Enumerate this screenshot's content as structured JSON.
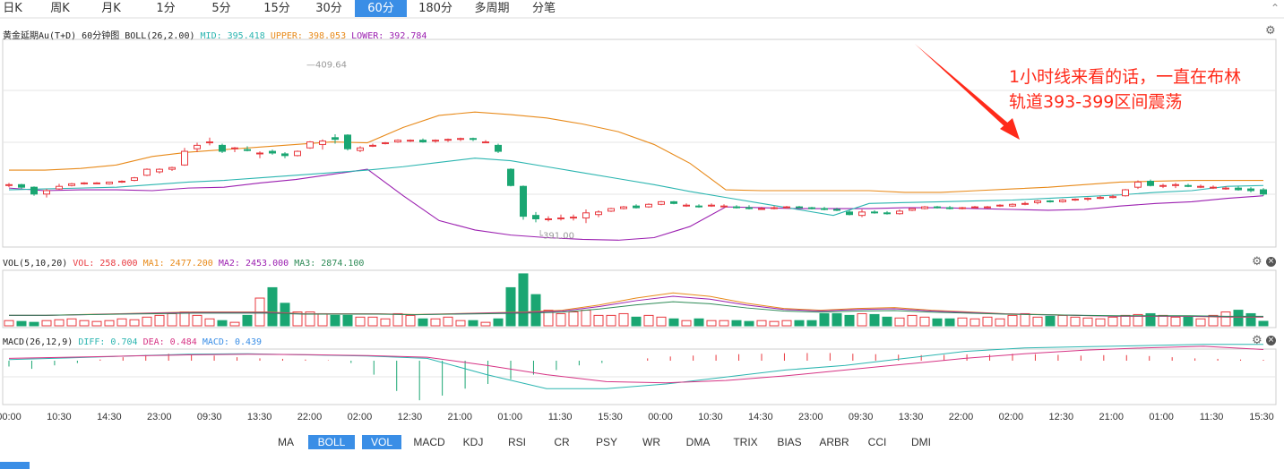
{
  "period_tabs": [
    {
      "label": "日K",
      "active": false
    },
    {
      "label": "周K",
      "active": false
    },
    {
      "label": "月K",
      "active": false
    },
    {
      "label": "1分",
      "active": false
    },
    {
      "label": "5分",
      "active": false
    },
    {
      "label": "15分",
      "active": false
    },
    {
      "label": "30分",
      "active": false
    },
    {
      "label": "60分",
      "active": true
    },
    {
      "label": "180分",
      "active": false
    },
    {
      "label": "多周期",
      "active": false
    },
    {
      "label": "分笔",
      "active": false
    }
  ],
  "boll_header": {
    "title": "黄金延期Au(T+D) 60分钟图 BOLL(26,2.00)",
    "mid": "MID: 395.418",
    "upper": "UPPER: 398.053",
    "lower": "LOWER: 392.784"
  },
  "vol_header": {
    "title": "VOL(5,10,20)",
    "vol": "VOL: 258.000",
    "ma1": "MA1: 2477.200",
    "ma2": "MA2: 2453.000",
    "ma3": "MA3: 2874.100"
  },
  "macd_header": {
    "title": "MACD(26,12,9)",
    "diff": "DIFF: 0.704",
    "dea": "DEA: 0.484",
    "macd": "MACD: 0.439"
  },
  "annotation": [
    "1小时线来看的话，一直在布林",
    "轨道393-399区间震荡"
  ],
  "price_marks": {
    "high": "409.64",
    "low": "391.00"
  },
  "x_axis_labels": [
    "00:00",
    "10:30",
    "14:30",
    "23:00",
    "09:30",
    "13:30",
    "22:00",
    "02:00",
    "12:30",
    "21:00",
    "01:00",
    "11:30",
    "15:30",
    "00:00",
    "10:30",
    "14:30",
    "23:00",
    "09:30",
    "13:30",
    "22:00",
    "02:00",
    "12:30",
    "21:00",
    "01:00",
    "11:30",
    "15:30"
  ],
  "indicator_tabs": [
    {
      "label": "MA",
      "active": false
    },
    {
      "label": "BOLL",
      "active": true
    },
    {
      "label": "VOL",
      "active": true
    },
    {
      "label": "MACD",
      "active": false
    },
    {
      "label": "KDJ",
      "active": false
    },
    {
      "label": "RSI",
      "active": false
    },
    {
      "label": "CR",
      "active": false
    },
    {
      "label": "PSY",
      "active": false
    },
    {
      "label": "WR",
      "active": false
    },
    {
      "label": "DMA",
      "active": false
    },
    {
      "label": "TRIX",
      "active": false
    },
    {
      "label": "BIAS",
      "active": false
    },
    {
      "label": "ARBR",
      "active": false
    },
    {
      "label": "CCI",
      "active": false
    },
    {
      "label": "DMI",
      "active": false
    }
  ],
  "colors": {
    "up": "#e8393f",
    "down": "#1aa672",
    "mid": "#2bb5b0",
    "upper": "#e88a1a",
    "lower": "#9b1fb0",
    "accent": "#3a8ee6",
    "annotation": "#ff2a1a",
    "ma1": "#e06666",
    "ma2": "#8a2be2",
    "ma3": "#2e8b57",
    "dea": "#d63384"
  },
  "chart_data": {
    "type": "candlestick",
    "title": "黄金延期Au(T+D) 60分钟图",
    "ylim": [
      388.2,
      412.5
    ],
    "candles": [
      [
        395.4,
        395.7,
        395.2,
        395.5
      ],
      [
        395.5,
        395.6,
        395.0,
        395.2
      ],
      [
        395.2,
        395.3,
        394.2,
        394.4
      ],
      [
        394.4,
        395.0,
        394.0,
        394.8
      ],
      [
        395.0,
        395.6,
        394.9,
        395.3
      ],
      [
        395.4,
        395.7,
        395.3,
        395.6
      ],
      [
        395.6,
        395.8,
        395.5,
        395.7
      ],
      [
        395.7,
        395.8,
        395.6,
        395.7
      ],
      [
        395.6,
        395.8,
        395.5,
        395.8
      ],
      [
        395.9,
        396.0,
        395.7,
        395.9
      ],
      [
        396.0,
        396.4,
        395.9,
        396.3
      ],
      [
        396.6,
        397.4,
        396.5,
        397.3
      ],
      [
        397.0,
        397.4,
        396.8,
        397.3
      ],
      [
        397.3,
        397.6,
        397.1,
        397.5
      ],
      [
        397.8,
        399.8,
        397.7,
        399.4
      ],
      [
        399.7,
        400.4,
        399.3,
        400.1
      ],
      [
        400.4,
        401.0,
        400.1,
        400.5
      ],
      [
        400.1,
        400.3,
        399.2,
        399.4
      ],
      [
        399.7,
        399.9,
        399.3,
        399.8
      ],
      [
        399.6,
        400.0,
        399.4,
        399.5
      ],
      [
        399.1,
        399.4,
        398.6,
        399.2
      ],
      [
        399.4,
        399.6,
        399.0,
        399.2
      ],
      [
        399.1,
        399.3,
        398.6,
        398.9
      ],
      [
        398.9,
        399.5,
        398.8,
        399.4
      ],
      [
        399.8,
        400.6,
        399.7,
        400.5
      ],
      [
        400.2,
        400.8,
        399.6,
        400.6
      ],
      [
        401.0,
        401.4,
        400.3,
        400.8
      ],
      [
        401.3,
        401.4,
        399.5,
        399.7
      ],
      [
        399.5,
        400.0,
        399.3,
        399.8
      ],
      [
        400.0,
        400.3,
        399.9,
        400.1
      ],
      [
        400.3,
        400.5,
        400.2,
        400.4
      ],
      [
        400.5,
        400.8,
        400.4,
        400.7
      ],
      [
        400.6,
        400.8,
        400.5,
        400.7
      ],
      [
        400.7,
        400.9,
        400.4,
        400.5
      ],
      [
        400.6,
        400.8,
        400.4,
        400.7
      ],
      [
        400.7,
        400.9,
        400.5,
        400.8
      ],
      [
        400.8,
        401.0,
        400.6,
        400.9
      ],
      [
        400.9,
        401.0,
        400.6,
        400.8
      ],
      [
        400.5,
        400.7,
        400.4,
        400.5
      ],
      [
        400.1,
        400.3,
        399.2,
        399.4
      ],
      [
        397.3,
        397.4,
        395.3,
        395.4
      ],
      [
        395.3,
        395.4,
        391.4,
        391.8
      ],
      [
        391.9,
        392.3,
        391.1,
        391.5
      ],
      [
        391.5,
        391.8,
        391.2,
        391.5
      ],
      [
        391.5,
        392.0,
        391.3,
        391.6
      ],
      [
        391.6,
        392.0,
        391.3,
        391.7
      ],
      [
        391.6,
        392.6,
        391.0,
        392.2
      ],
      [
        392.0,
        392.5,
        391.7,
        392.3
      ],
      [
        392.4,
        392.8,
        392.3,
        392.7
      ],
      [
        392.7,
        393.0,
        392.6,
        392.9
      ],
      [
        393.0,
        393.2,
        392.7,
        392.8
      ],
      [
        392.9,
        393.3,
        392.8,
        393.2
      ],
      [
        393.2,
        393.6,
        393.1,
        393.5
      ],
      [
        393.5,
        393.6,
        393.2,
        393.3
      ],
      [
        393.1,
        393.3,
        392.9,
        393.1
      ],
      [
        393.0,
        393.2,
        392.8,
        392.9
      ],
      [
        393.0,
        393.3,
        392.9,
        393.1
      ],
      [
        393.0,
        393.2,
        392.9,
        393.0
      ],
      [
        392.9,
        393.1,
        392.7,
        392.8
      ],
      [
        392.8,
        393.1,
        392.6,
        392.7
      ],
      [
        392.7,
        392.9,
        392.6,
        392.7
      ],
      [
        392.8,
        393.0,
        392.6,
        392.8
      ],
      [
        392.8,
        393.0,
        392.7,
        392.9
      ],
      [
        392.9,
        393.0,
        392.7,
        392.8
      ],
      [
        392.8,
        392.9,
        392.6,
        392.7
      ],
      [
        392.7,
        392.9,
        392.5,
        392.6
      ],
      [
        392.6,
        392.8,
        392.4,
        392.5
      ],
      [
        392.3,
        392.5,
        391.9,
        392.0
      ],
      [
        391.9,
        392.6,
        391.7,
        392.3
      ],
      [
        392.3,
        392.5,
        392.1,
        392.2
      ],
      [
        392.2,
        392.4,
        392.0,
        392.1
      ],
      [
        392.1,
        392.6,
        392.0,
        392.4
      ],
      [
        392.5,
        392.8,
        392.4,
        392.7
      ],
      [
        392.7,
        393.0,
        392.6,
        392.9
      ],
      [
        392.9,
        393.0,
        392.7,
        392.8
      ],
      [
        392.8,
        393.0,
        392.6,
        392.7
      ],
      [
        392.7,
        392.9,
        392.6,
        392.8
      ],
      [
        392.8,
        393.0,
        392.7,
        392.9
      ],
      [
        392.8,
        393.0,
        392.7,
        392.9
      ],
      [
        393.0,
        393.2,
        392.9,
        393.1
      ],
      [
        393.0,
        393.3,
        392.9,
        393.2
      ],
      [
        393.2,
        393.5,
        393.1,
        393.3
      ],
      [
        393.4,
        393.7,
        393.2,
        393.6
      ],
      [
        393.6,
        393.7,
        393.4,
        393.5
      ],
      [
        393.5,
        393.8,
        393.4,
        393.7
      ],
      [
        393.7,
        393.9,
        393.6,
        393.8
      ],
      [
        393.8,
        394.0,
        393.6,
        393.9
      ],
      [
        393.9,
        394.2,
        393.8,
        394.0
      ],
      [
        394.0,
        394.3,
        393.9,
        394.1
      ],
      [
        394.2,
        395.0,
        394.1,
        394.9
      ],
      [
        395.2,
        396.0,
        395.0,
        395.8
      ],
      [
        395.9,
        396.1,
        395.3,
        395.4
      ],
      [
        395.3,
        395.6,
        395.1,
        395.4
      ],
      [
        395.4,
        395.7,
        395.1,
        395.5
      ],
      [
        395.4,
        395.6,
        395.2,
        395.3
      ],
      [
        395.3,
        395.5,
        395.1,
        395.3
      ],
      [
        395.2,
        395.4,
        395.0,
        395.2
      ],
      [
        395.1,
        395.3,
        394.9,
        395.1
      ],
      [
        395.1,
        395.3,
        394.8,
        394.9
      ],
      [
        395.0,
        395.2,
        394.6,
        394.8
      ],
      [
        394.9,
        395.1,
        394.2,
        394.4
      ]
    ],
    "mid": [
      394.9,
      395.0,
      395.1,
      395.2,
      395.5,
      395.8,
      396.0,
      396.3,
      396.6,
      396.9,
      397.2,
      397.6,
      398.1,
      398.6,
      398.3,
      397.6,
      396.9,
      396.2,
      395.5,
      394.7,
      394.0,
      393.3,
      392.6,
      391.9,
      393.3,
      393.4,
      393.5,
      393.6,
      393.7,
      393.9,
      394.1,
      394.3,
      394.6,
      394.8,
      395.3,
      395.4
    ],
    "upper": [
      397.2,
      397.2,
      397.4,
      397.8,
      398.8,
      399.3,
      399.6,
      399.9,
      400.2,
      400.5,
      400.4,
      402.2,
      403.6,
      404.0,
      403.7,
      403.3,
      402.6,
      401.7,
      400.2,
      398.0,
      394.9,
      394.8,
      394.8,
      394.8,
      394.8,
      394.6,
      394.6,
      394.8,
      395.0,
      395.2,
      395.5,
      395.8,
      395.9,
      396.0,
      396.0,
      396.0
    ],
    "lower": [
      395.1,
      394.8,
      394.9,
      394.9,
      394.8,
      395.1,
      395.2,
      395.7,
      396.1,
      396.7,
      397.3,
      394.2,
      391.3,
      390.2,
      389.6,
      389.3,
      389.1,
      389.0,
      389.3,
      390.6,
      392.9,
      392.8,
      392.7,
      392.7,
      392.7,
      392.8,
      392.8,
      392.7,
      392.6,
      392.5,
      392.6,
      393.0,
      393.3,
      393.5,
      393.9,
      394.2
    ],
    "volume": [
      300,
      250,
      200,
      300,
      350,
      400,
      300,
      250,
      300,
      400,
      350,
      500,
      600,
      700,
      800,
      600,
      400,
      300,
      200,
      600,
      1600,
      2200,
      1300,
      800,
      800,
      700,
      600,
      600,
      500,
      500,
      400,
      700,
      600,
      400,
      400,
      500,
      300,
      300,
      200,
      400,
      2200,
      3000,
      1800,
      900,
      700,
      800,
      900,
      600,
      600,
      700,
      500,
      600,
      500,
      400,
      300,
      400,
      300,
      300,
      300,
      250,
      300,
      250,
      300,
      300,
      300,
      700,
      700,
      600,
      700,
      650,
      500,
      450,
      600,
      500,
      400,
      400,
      450,
      400,
      500,
      400,
      600,
      700,
      500,
      550,
      600,
      500,
      450,
      400,
      500,
      600,
      650,
      700,
      600,
      500,
      500,
      400,
      600,
      800,
      900,
      700,
      258
    ],
    "vol_ma1": [
      600,
      600,
      650,
      700,
      750,
      800,
      800,
      800,
      700,
      700,
      700,
      650,
      700,
      750,
      800,
      900,
      1200,
      1600,
      1900,
      1700,
      1300,
      1000,
      900,
      1000,
      1050,
      900,
      800,
      700,
      650,
      600,
      550,
      550,
      550,
      500,
      500
    ],
    "macd_hist_sample": [
      -0.25,
      -0.35,
      -0.2,
      -0.1,
      0.05,
      0.15,
      0.25,
      0.3,
      0.28,
      0.22,
      0.15,
      0.1,
      0.08,
      0.05,
      0.02,
      -0.1,
      -0.6,
      -1.3,
      -1.7,
      -1.5,
      -1.2,
      -1.0,
      -0.8,
      -0.6,
      -0.4,
      -0.2,
      -0.1,
      0.0,
      0.1,
      0.18,
      0.22,
      0.25,
      0.28,
      0.3,
      0.32,
      0.33,
      0.33,
      0.3,
      0.28,
      0.26,
      0.24,
      0.25,
      0.27,
      0.26,
      0.3,
      0.28,
      0.25,
      0.22,
      0.24,
      0.24,
      0.2,
      0.15,
      0.1,
      0.08,
      0.05,
      0.04
    ],
    "diff": [
      0.05,
      0.12,
      0.2,
      0.28,
      0.3,
      0.25,
      0.2,
      0.1,
      -0.6,
      -1.2,
      -1.2,
      -1.0,
      -0.7,
      -0.4,
      -0.2,
      0.1,
      0.4,
      0.55,
      0.6,
      0.65,
      0.7,
      0.7
    ],
    "dea": [
      0.1,
      0.15,
      0.2,
      0.25,
      0.28,
      0.26,
      0.22,
      0.15,
      -0.2,
      -0.6,
      -0.9,
      -0.95,
      -0.85,
      -0.65,
      -0.4,
      -0.15,
      0.1,
      0.3,
      0.45,
      0.55,
      0.62,
      0.48
    ]
  }
}
